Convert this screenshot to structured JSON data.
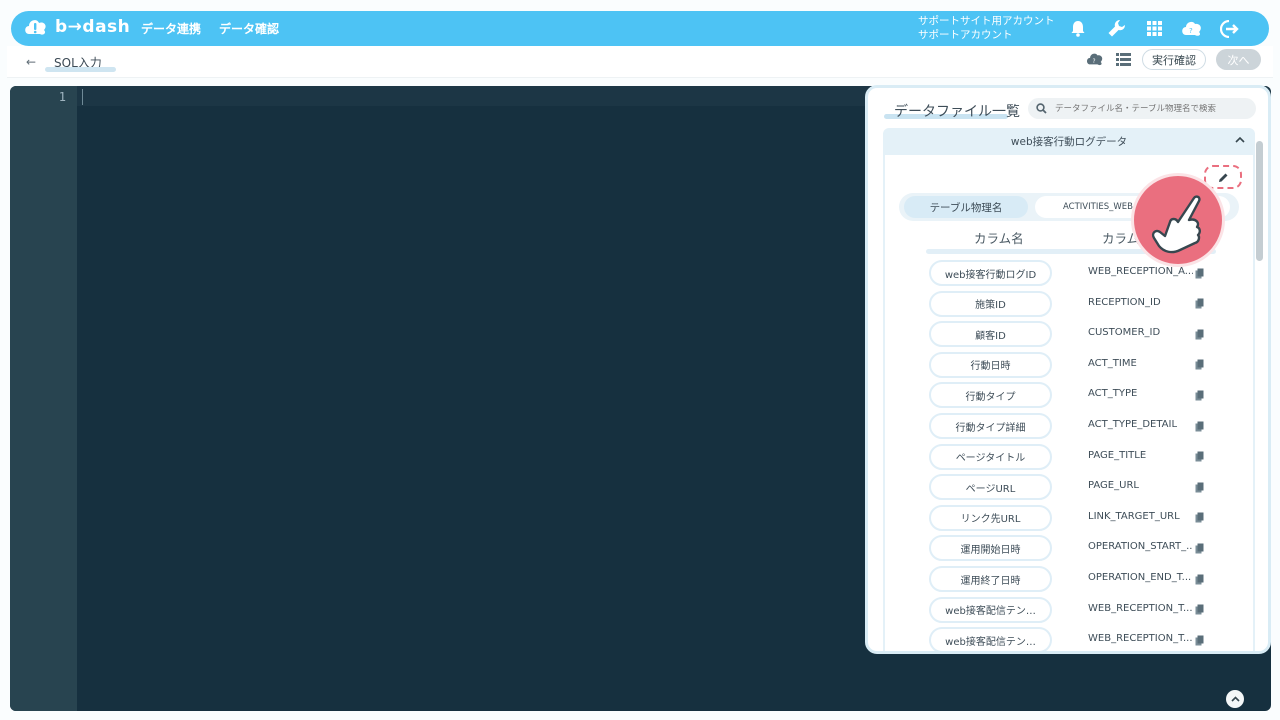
{
  "header": {
    "logo_text": "b→dash",
    "nav": [
      "データ連携",
      "データ確認"
    ],
    "account_line1": "サポートサイト用アカウント",
    "account_line2": "サポートアカウント",
    "icons": [
      "bell-icon",
      "wrench-icon",
      "grid-icon",
      "chat-icon",
      "logout-icon"
    ],
    "brand_color": "#4dc3f4"
  },
  "subheader": {
    "back_glyph": "←",
    "breadcrumb": "SQL入力",
    "exec_label": "実行確認",
    "next_label": "次へ"
  },
  "editor": {
    "line_number": "1",
    "bg_color": "#16303f"
  },
  "panel": {
    "title": "データファイル一覧",
    "search_placeholder": "データファイル名・テーブル物理名で検索",
    "accordion_title": "web接客行動ログデータ",
    "physical_label": "テーブル物理名",
    "physical_value": "ACTIVITIES_WEB_",
    "col_logical": "カラム名",
    "col_physical": "カラム",
    "rows": [
      {
        "logical": "web接客行動ログID",
        "physical": "WEB_RECEPTION_A..."
      },
      {
        "logical": "施策ID",
        "physical": "RECEPTION_ID"
      },
      {
        "logical": "顧客ID",
        "physical": "CUSTOMER_ID"
      },
      {
        "logical": "行動日時",
        "physical": "ACT_TIME"
      },
      {
        "logical": "行動タイプ",
        "physical": "ACT_TYPE"
      },
      {
        "logical": "行動タイプ詳細",
        "physical": "ACT_TYPE_DETAIL"
      },
      {
        "logical": "ページタイトル",
        "physical": "PAGE_TITLE"
      },
      {
        "logical": "ページURL",
        "physical": "PAGE_URL"
      },
      {
        "logical": "リンク先URL",
        "physical": "LINK_TARGET_URL"
      },
      {
        "logical": "運用開始日時",
        "physical": "OPERATION_START_..."
      },
      {
        "logical": "運用終了日時",
        "physical": "OPERATION_END_T..."
      },
      {
        "logical": "web接客配信テン…",
        "physical": "WEB_RECEPTION_T..."
      },
      {
        "logical": "web接客配信テン…",
        "physical": "WEB_RECEPTION_T..."
      }
    ],
    "highlight_color": "#ea6f7f"
  }
}
